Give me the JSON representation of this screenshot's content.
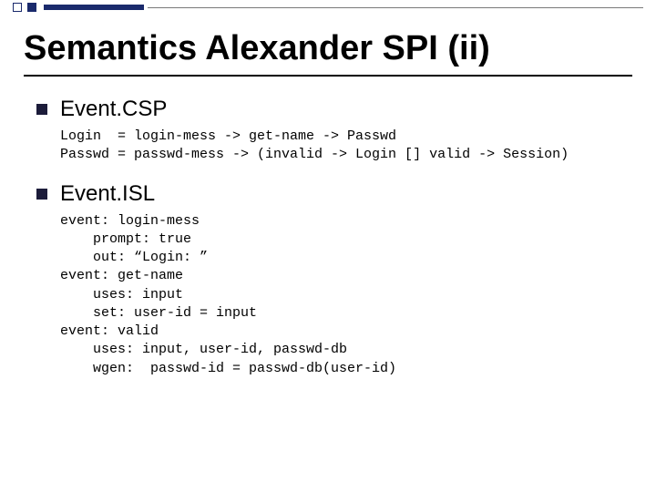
{
  "slide": {
    "title": "Semantics Alexander SPI (ii)"
  },
  "sections": [
    {
      "heading": "Event.CSP",
      "code": "Login  = login-mess -> get-name -> Passwd\nPasswd = passwd-mess -> (invalid -> Login [] valid -> Session)"
    },
    {
      "heading": "Event.ISL",
      "code": "event: login-mess\n    prompt: true\n    out: “Login: ”\nevent: get-name\n    uses: input\n    set: user-id = input\nevent: valid\n    uses: input, user-id, passwd-db\n    wgen:  passwd-id = passwd-db(user-id)"
    }
  ]
}
